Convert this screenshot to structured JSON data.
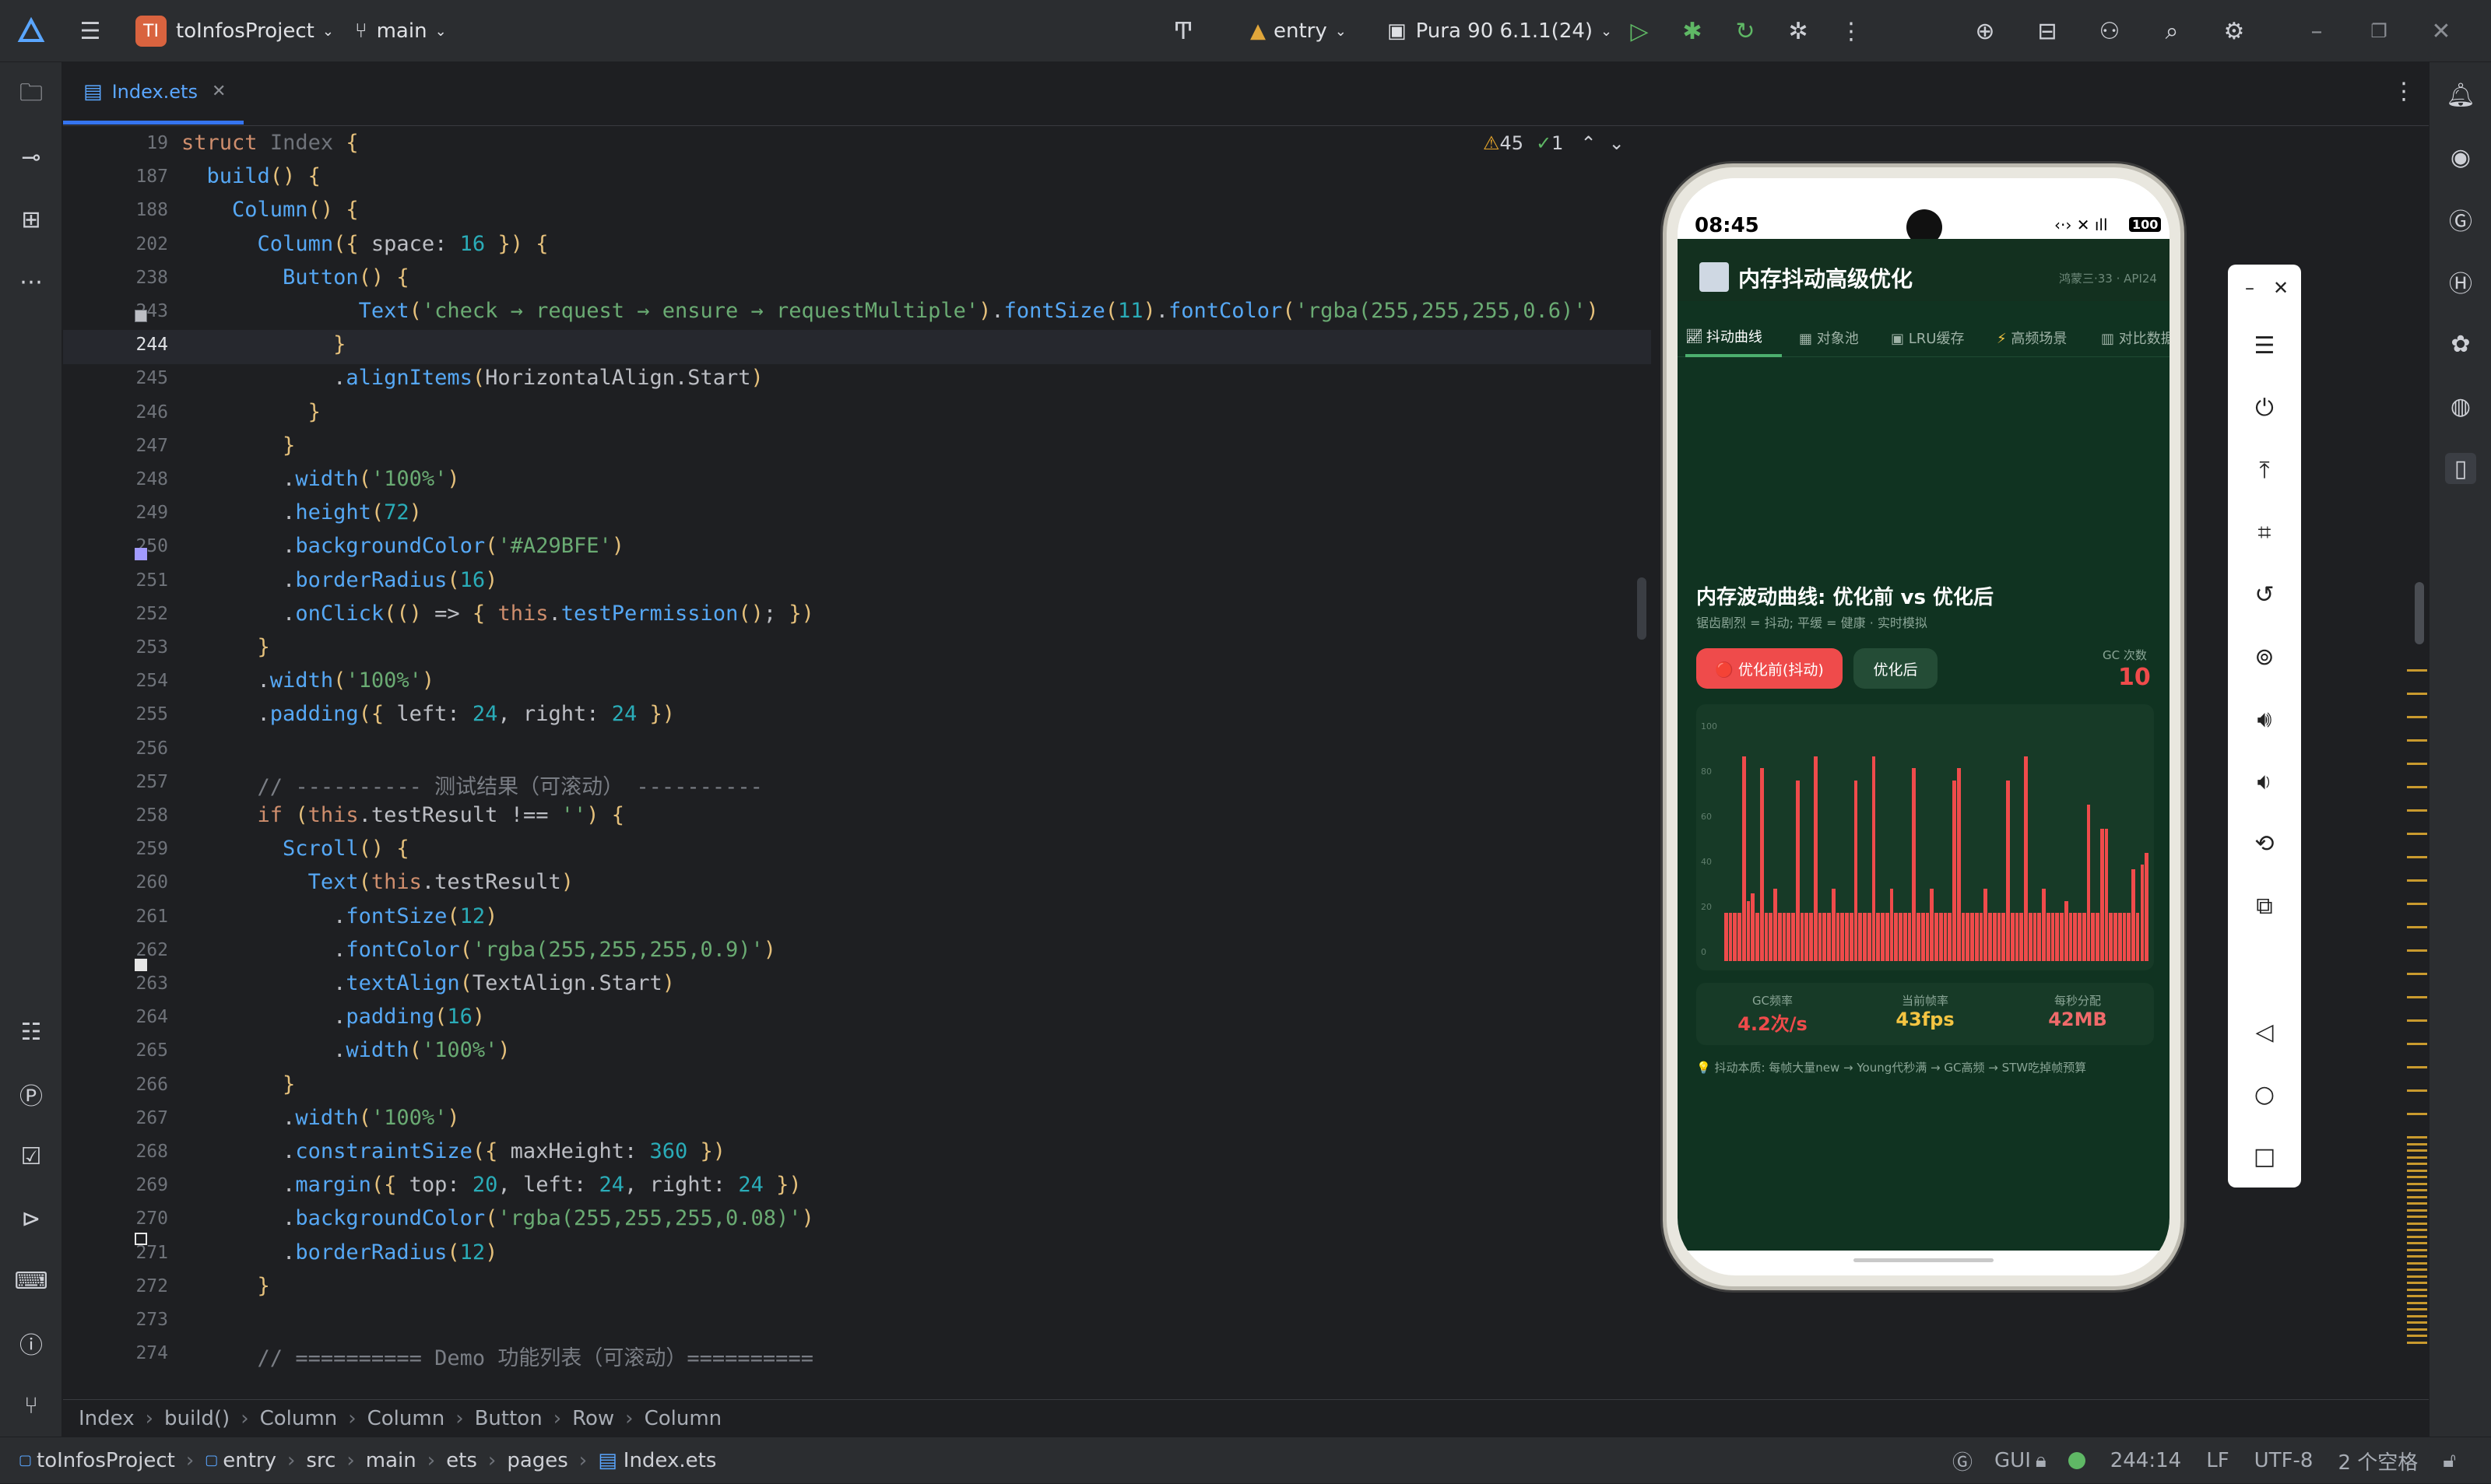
{
  "titlebar": {
    "project_badge": "TI",
    "project": "toInfosProject",
    "branch": "main",
    "module": "entry",
    "device": "Pura 90 6.1.1(24)"
  },
  "editor": {
    "tab": "Index.ets",
    "warnings": "45",
    "checks": "1",
    "lines": [
      {
        "n": "19",
        "html": "<span class='kw'>struct</span> <span class='gray'>Index</span> <span class='br'>{</span>"
      },
      {
        "n": "187",
        "html": "  <span class='fn'>build</span><span class='br'>()</span> <span class='br'>{</span>"
      },
      {
        "n": "188",
        "html": "    <span class='fn'>Column</span><span class='br'>()</span> <span class='br'>{</span>"
      },
      {
        "n": "202",
        "html": "      <span class='fn'>Column</span><span class='br'>({</span> space: <span class='num'>16</span> <span class='br'>})</span> <span class='br'>{</span>"
      },
      {
        "n": "238",
        "html": "        <span class='fn'>Button</span><span class='br'>()</span> <span class='br'>{</span>"
      },
      {
        "n": "243",
        "html": "              <span class='fn'>Text</span><span class='br'>(</span><span class='str'>'check → request → ensure → requestMultiple'</span><span class='br'>)</span>.<span class='fn'>fontSize</span><span class='br'>(</span><span class='num'>11</span><span class='br'>)</span>.<span class='fn'>fontColor</span><span class='br'>(</span><span class='str'>'rgba(255,255,255,0.6)'</span><span class='br'>)</span>"
      },
      {
        "n": "244",
        "html": "            <span class='br'>}</span>"
      },
      {
        "n": "245",
        "html": "            .<span class='fn'>alignItems</span><span class='br'>(</span>HorizontalAlign.Start<span class='br'>)</span>"
      },
      {
        "n": "246",
        "html": "          <span class='br'>}</span>"
      },
      {
        "n": "247",
        "html": "        <span class='br'>}</span>"
      },
      {
        "n": "248",
        "html": "        .<span class='fn'>width</span><span class='br'>(</span><span class='str'>'100%'</span><span class='br'>)</span>"
      },
      {
        "n": "249",
        "html": "        .<span class='fn'>height</span><span class='br'>(</span><span class='num'>72</span><span class='br'>)</span>"
      },
      {
        "n": "250",
        "html": "        .<span class='fn'>backgroundColor</span><span class='br'>(</span><span class='str'>'#A29BFE'</span><span class='br'>)</span>"
      },
      {
        "n": "251",
        "html": "        .<span class='fn'>borderRadius</span><span class='br'>(</span><span class='num'>16</span><span class='br'>)</span>"
      },
      {
        "n": "252",
        "html": "        .<span class='fn'>onClick</span><span class='br'>(()</span> => <span class='br'>{</span> <span class='kw'>this</span>.<span class='fn'>testPermission</span><span class='br'>()</span>; <span class='br'>})</span>"
      },
      {
        "n": "253",
        "html": "      <span class='br'>}</span>"
      },
      {
        "n": "254",
        "html": "      .<span class='fn'>width</span><span class='br'>(</span><span class='str'>'100%'</span><span class='br'>)</span>"
      },
      {
        "n": "255",
        "html": "      .<span class='fn'>padding</span><span class='br'>({</span> left: <span class='num'>24</span>, right: <span class='num'>24</span> <span class='br'>})</span>"
      },
      {
        "n": "256",
        "html": ""
      },
      {
        "n": "257",
        "html": "      <span class='cm'>// ---------- 测试结果（可滚动） ----------</span>"
      },
      {
        "n": "258",
        "html": "      <span class='kw'>if</span> <span class='br'>(</span><span class='kw'>this</span>.testResult !== <span class='str'>''</span><span class='br'>)</span> <span class='br'>{</span>"
      },
      {
        "n": "259",
        "html": "        <span class='fn'>Scroll</span><span class='br'>()</span> <span class='br'>{</span>"
      },
      {
        "n": "260",
        "html": "          <span class='fn'>Text</span><span class='br'>(</span><span class='kw'>this</span>.testResult<span class='br'>)</span>"
      },
      {
        "n": "261",
        "html": "            .<span class='fn'>fontSize</span><span class='br'>(</span><span class='num'>12</span><span class='br'>)</span>"
      },
      {
        "n": "262",
        "html": "            .<span class='fn'>fontColor</span><span class='br'>(</span><span class='str'>'rgba(255,255,255,0.9)'</span><span class='br'>)</span>"
      },
      {
        "n": "263",
        "html": "            .<span class='fn'>textAlign</span><span class='br'>(</span>TextAlign.Start<span class='br'>)</span>"
      },
      {
        "n": "264",
        "html": "            .<span class='fn'>padding</span><span class='br'>(</span><span class='num'>16</span><span class='br'>)</span>"
      },
      {
        "n": "265",
        "html": "            .<span class='fn'>width</span><span class='br'>(</span><span class='str'>'100%'</span><span class='br'>)</span>"
      },
      {
        "n": "266",
        "html": "        <span class='br'>}</span>"
      },
      {
        "n": "267",
        "html": "        .<span class='fn'>width</span><span class='br'>(</span><span class='str'>'100%'</span><span class='br'>)</span>"
      },
      {
        "n": "268",
        "html": "        .<span class='fn'>constraintSize</span><span class='br'>({</span> maxHeight: <span class='num'>360</span> <span class='br'>})</span>"
      },
      {
        "n": "269",
        "html": "        .<span class='fn'>margin</span><span class='br'>({</span> top: <span class='num'>20</span>, left: <span class='num'>24</span>, right: <span class='num'>24</span> <span class='br'>})</span>"
      },
      {
        "n": "270",
        "html": "        .<span class='fn'>backgroundColor</span><span class='br'>(</span><span class='str'>'rgba(255,255,255,0.08)'</span><span class='br'>)</span>"
      },
      {
        "n": "271",
        "html": "        .<span class='fn'>borderRadius</span><span class='br'>(</span><span class='num'>12</span><span class='br'>)</span>"
      },
      {
        "n": "272",
        "html": "      <span class='br'>}</span>"
      },
      {
        "n": "273",
        "html": ""
      },
      {
        "n": "274",
        "html": "      <span class='cm'>// ========== Demo 功能列表（可滚动）==========</span>"
      }
    ]
  },
  "breadcrumbs": [
    "Index",
    "build()",
    "Column",
    "Column",
    "Button",
    "Row",
    "Column"
  ],
  "status": {
    "path": [
      "toInfosProject",
      "entry",
      "src",
      "main",
      "ets",
      "pages",
      "Index.ets"
    ],
    "gui": "GUI",
    "position": "244:14",
    "line_sep": "LF",
    "encoding": "UTF-8",
    "indent": "2 个空格"
  },
  "phone": {
    "time": "08:45",
    "battery": "100",
    "app_title": "内存抖动高级优化",
    "app_sub": "鸿蒙三·33 · API24",
    "tabs": [
      "抖动曲线",
      "对象池",
      "LRU缓存",
      "高频场景",
      "对比数据"
    ],
    "section_title": "内存波动曲线: 优化前 vs 优化后",
    "section_sub": "锯齿剧烈 = 抖动; 平缓 = 健康 · 实时模拟",
    "btn_before": "🔴 优化前(抖动)",
    "btn_after": "优化后",
    "gc_label": "GC 次数",
    "gc_value": "10",
    "stats": [
      {
        "label": "GC频率",
        "value": "4.2次/s",
        "color": "#ef4b4b"
      },
      {
        "label": "当前帧率",
        "value": "43fps",
        "color": "#f5c542"
      },
      {
        "label": "每秒分配",
        "value": "42MB",
        "color": "#ef6a6a"
      }
    ],
    "note": "💡 抖动本质: 每帧大量new → Young代秒满 → GC高频 → STW吃掉帧预算"
  },
  "chart_data": {
    "type": "bar",
    "yticks": [
      "100",
      "80",
      "60",
      "40",
      "20",
      "0"
    ],
    "ylim": [
      0,
      100
    ],
    "values": [
      20,
      20,
      20,
      20,
      85,
      25,
      28,
      20,
      80,
      20,
      20,
      30,
      20,
      20,
      20,
      20,
      75,
      20,
      20,
      20,
      85,
      20,
      20,
      20,
      30,
      20,
      20,
      20,
      20,
      75,
      20,
      20,
      20,
      85,
      20,
      20,
      20,
      30,
      20,
      20,
      20,
      20,
      80,
      20,
      20,
      20,
      30,
      20,
      20,
      20,
      20,
      75,
      80,
      20,
      20,
      20,
      20,
      20,
      30,
      20,
      20,
      20,
      20,
      75,
      20,
      20,
      20,
      85,
      20,
      20,
      20,
      30,
      20,
      20,
      20,
      20,
      25,
      20,
      20,
      20,
      20,
      65,
      20,
      20,
      55,
      55,
      20,
      20,
      20,
      20,
      20,
      38,
      20,
      40,
      45
    ]
  }
}
